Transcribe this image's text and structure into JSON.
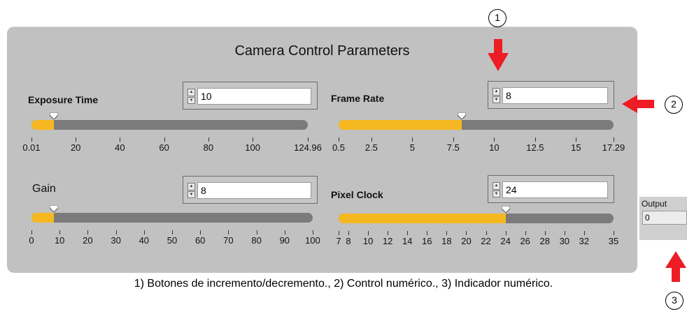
{
  "panel": {
    "title": "Camera Control Parameters"
  },
  "controls": {
    "exposure": {
      "label": "Exposure Time",
      "value": "10",
      "min": 0.01,
      "max": 124.96,
      "ticks": [
        "0.01",
        "20",
        "40",
        "60",
        "80",
        "100",
        "124.96"
      ]
    },
    "framerate": {
      "label": "Frame Rate",
      "value": "8",
      "min": 0.5,
      "max": 17.29,
      "ticks": [
        "0.5",
        "2.5",
        "5",
        "7.5",
        "10",
        "12.5",
        "15",
        "17.29"
      ]
    },
    "gain": {
      "label": "Gain",
      "value": "8",
      "min": 0,
      "max": 100,
      "ticks": [
        "0",
        "10",
        "20",
        "30",
        "40",
        "50",
        "60",
        "70",
        "80",
        "90",
        "100"
      ]
    },
    "pixelclock": {
      "label": "Pixel Clock",
      "value": "24",
      "min": 7,
      "max": 35,
      "ticks": [
        "7",
        "8",
        "10",
        "12",
        "14",
        "16",
        "18",
        "20",
        "22",
        "24",
        "26",
        "28",
        "30",
        "32",
        "35"
      ]
    }
  },
  "output": {
    "label": "Output",
    "value": "0"
  },
  "callouts": {
    "one": "1",
    "two": "2",
    "three": "3"
  },
  "caption": "1) Botones de incremento/decremento., 2) Control numérico., 3) Indicador numérico.",
  "colors": {
    "panel": "#c1c1c1",
    "fill": "#f6b820",
    "track": "#7b7b7b",
    "arrow": "#ee1c24"
  },
  "icons": {
    "spin_up": "triangle-up",
    "spin_down": "triangle-down",
    "pointer": "slider-pointer",
    "arrow": "red-arrow"
  }
}
